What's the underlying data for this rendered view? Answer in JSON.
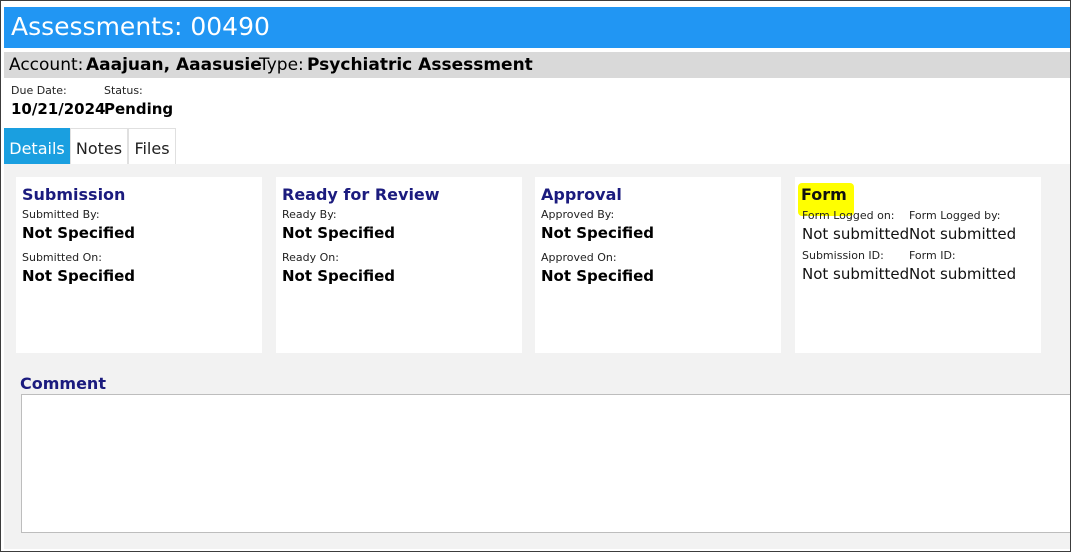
{
  "header": {
    "title": "Assessments: 00490"
  },
  "account_bar": {
    "account_label": "Account:",
    "account_name": "Aaajuan, Aaasusie",
    "type_label": "Type:",
    "type_value": "Psychiatric Assessment"
  },
  "meta": {
    "due_date_label": "Due Date:",
    "due_date_value": "10/21/2024",
    "status_label": "Status:",
    "status_value": "Pending"
  },
  "tabs": [
    {
      "label": "Details",
      "active": true
    },
    {
      "label": "Notes",
      "active": false
    },
    {
      "label": "Files",
      "active": false
    }
  ],
  "cards": {
    "submission": {
      "heading": "Submission",
      "by_label": "Submitted By:",
      "by_value": "Not Specified",
      "on_label": "Submitted On:",
      "on_value": "Not Specified"
    },
    "review": {
      "heading": "Ready for Review",
      "by_label": "Ready By:",
      "by_value": "Not Specified",
      "on_label": "Ready On:",
      "on_value": "Not Specified"
    },
    "approval": {
      "heading": "Approval",
      "by_label": "Approved By:",
      "by_value": "Not Specified",
      "on_label": "Approved On:",
      "on_value": "Not Specified"
    },
    "form": {
      "heading": "Form",
      "logged_on_label": "Form Logged on:",
      "logged_on_value": "Not submitted",
      "logged_by_label": "Form Logged by:",
      "logged_by_value": "Not submitted",
      "submission_id_label": "Submission ID:",
      "submission_id_value": "Not submitted",
      "form_id_label": "Form ID:",
      "form_id_value": "Not submitted"
    }
  },
  "comment": {
    "label": "Comment",
    "value": ""
  },
  "colors": {
    "title_bar": "#2196f3",
    "active_tab": "#1a9fe0",
    "heading": "#1b1b7e",
    "highlight": "#ffff00",
    "account_bar": "#d9d9d9"
  }
}
